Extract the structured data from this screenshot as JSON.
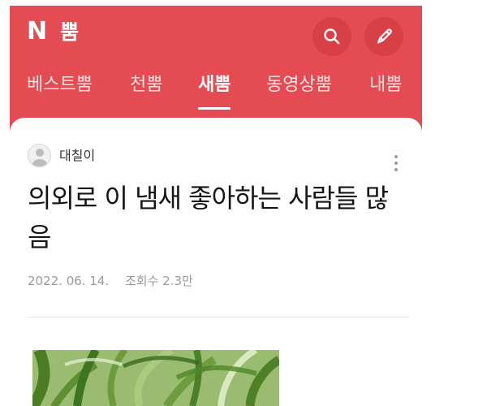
{
  "app": {
    "logo_letter": "N",
    "logo_text": "뿜",
    "search_button": "search-icon",
    "write_button": "pencil-icon"
  },
  "tabs": [
    {
      "label": "베스트뿜",
      "active": false
    },
    {
      "label": "천뿜",
      "active": false
    },
    {
      "label": "새뿜",
      "active": true
    },
    {
      "label": "동영상뿜",
      "active": false
    },
    {
      "label": "내뿜",
      "active": false
    }
  ],
  "post": {
    "author": "대칠이",
    "title": "의외로 이 냄새 좋아하는 사람들 많음",
    "date": "2022. 06. 14.",
    "views": "조회수 2.3만"
  },
  "colors": {
    "brand_red": "#e54b52",
    "button_red": "#d83f47",
    "text_dark": "#151515",
    "meta_gray": "#9a9a9a"
  }
}
